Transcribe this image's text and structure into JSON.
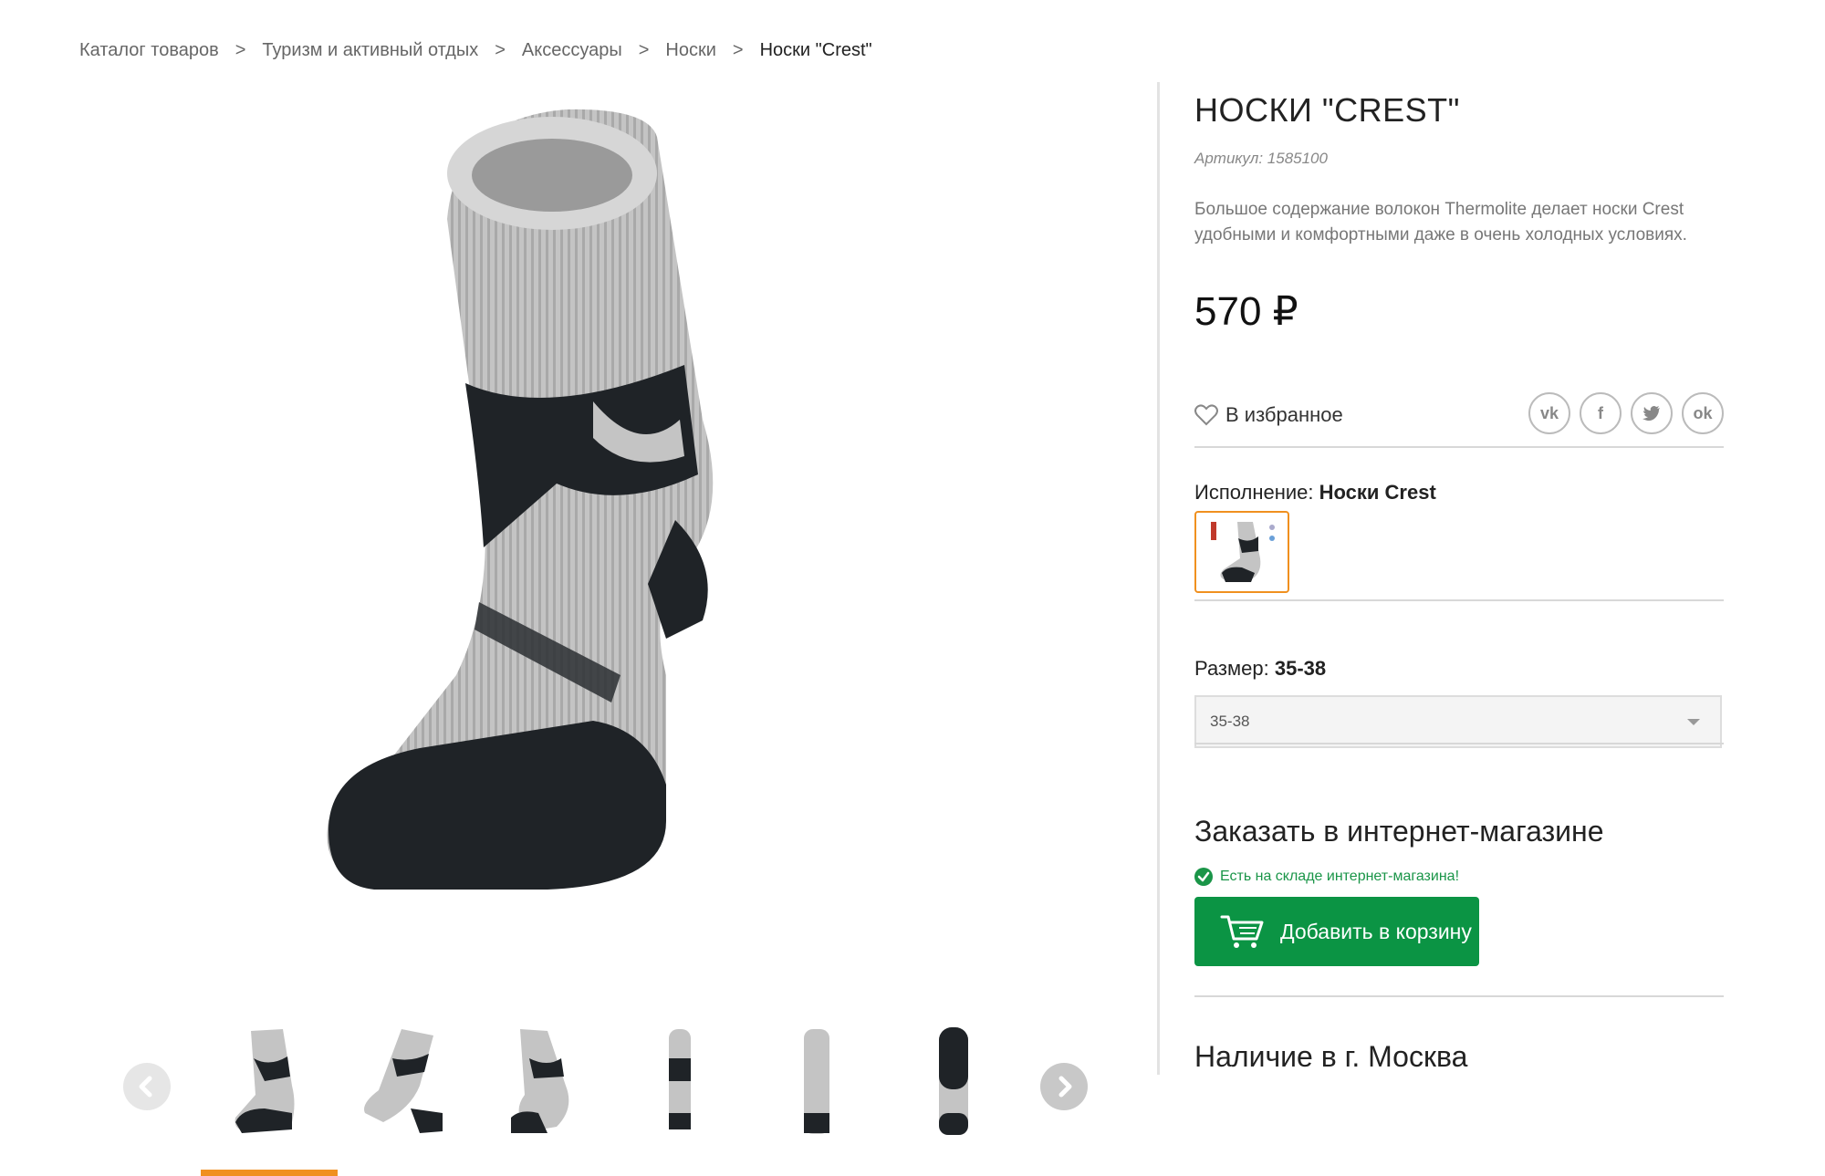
{
  "breadcrumb": {
    "items": [
      "Каталог товаров",
      "Туризм и активный отдых",
      "Аксессуары",
      "Носки"
    ],
    "current": "Носки \"Crest\"",
    "separator": ">"
  },
  "product": {
    "title": "НОСКИ \"CREST\"",
    "sku": "Артикул: 1585100",
    "description": "Большое содержание волокон Thermolite делает носки Crest удобными и комфортными даже в очень холодных условиях.",
    "price": "570 ₽"
  },
  "favorites": {
    "label": "В избранное"
  },
  "social": {
    "vk": "vk",
    "facebook": "f",
    "ok": "ok"
  },
  "variant": {
    "label": "Исполнение:",
    "value": "Носки Crest"
  },
  "size": {
    "label": "Размер:",
    "value": "35-38",
    "selected": "35-38"
  },
  "order": {
    "title": "Заказать в интернет-магазине",
    "stock": "Есть на складе интернет-магазина!",
    "cart_button": "Добавить в корзину"
  },
  "availability": {
    "title": "Наличие в г. Москва"
  },
  "colors": {
    "accent": "#f0901f",
    "green": "#0b9444",
    "stock_green": "#1a9548"
  }
}
